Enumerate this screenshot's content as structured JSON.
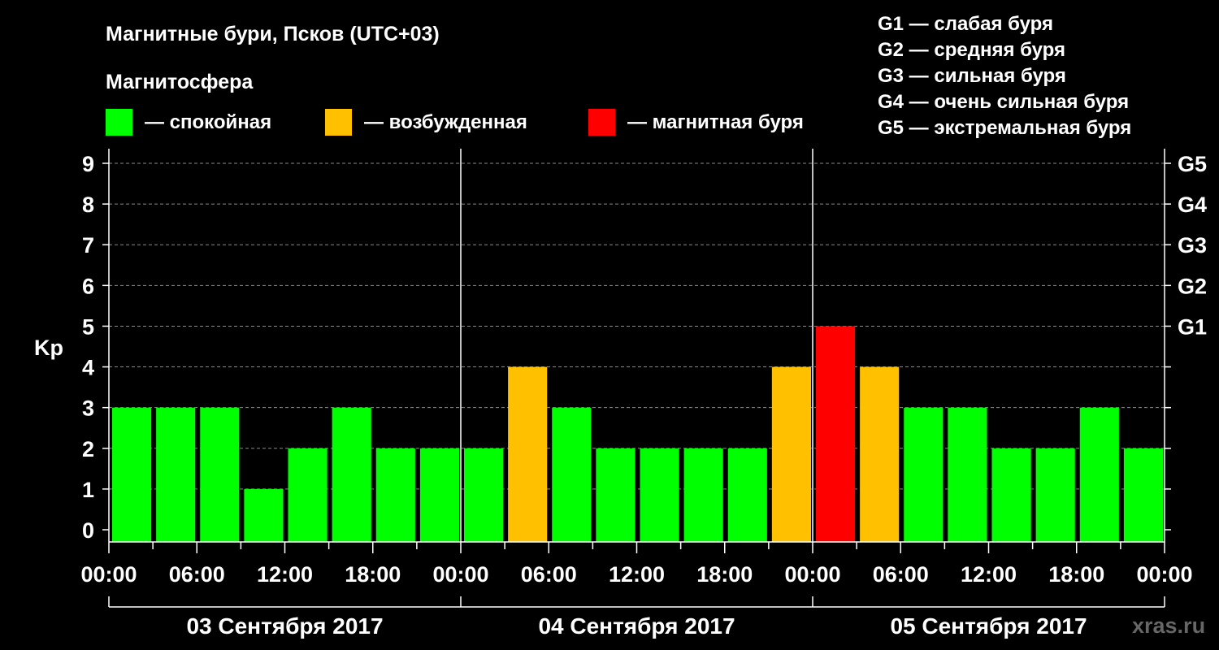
{
  "title": "Магнитные бури, Псков (UTC+03)",
  "legend": {
    "heading": "Магнитосфера",
    "items": [
      {
        "label": "— спокойная",
        "color": "#00ff00"
      },
      {
        "label": "— возбужденная",
        "color": "#ffc000"
      },
      {
        "label": "— магнитная буря",
        "color": "#ff0000"
      }
    ]
  },
  "g_scale": [
    "G1 — слабая буря",
    "G2 — средняя буря",
    "G3 — сильная буря",
    "G4 — очень сильная буря",
    "G5 — экстремальная буря"
  ],
  "source": "xras.ru",
  "chart_data": {
    "type": "bar",
    "ylabel": "Kp",
    "ylim": [
      0,
      9
    ],
    "y_ticks": [
      "0",
      "1",
      "2",
      "3",
      "4",
      "5",
      "6",
      "7",
      "8",
      "9"
    ],
    "right_axis": [
      {
        "kp": 5,
        "label": "G1"
      },
      {
        "kp": 6,
        "label": "G2"
      },
      {
        "kp": 7,
        "label": "G3"
      },
      {
        "kp": 8,
        "label": "G4"
      },
      {
        "kp": 9,
        "label": "G5"
      }
    ],
    "x_ticks": [
      "00:00",
      "06:00",
      "12:00",
      "18:00",
      "00:00",
      "06:00",
      "12:00",
      "18:00",
      "00:00",
      "06:00",
      "12:00",
      "18:00",
      "00:00"
    ],
    "days": [
      "03 Сентября 2017",
      "04 Сентября 2017",
      "05 Сентября 2017"
    ],
    "values": [
      3,
      3,
      3,
      1,
      2,
      3,
      2,
      2,
      2,
      4,
      3,
      2,
      2,
      2,
      2,
      4,
      5,
      4,
      3,
      3,
      2,
      2,
      3,
      2
    ],
    "colors": {
      "quiet": "#00ff00",
      "active": "#ffc000",
      "storm": "#ff0000"
    },
    "grid": true
  }
}
